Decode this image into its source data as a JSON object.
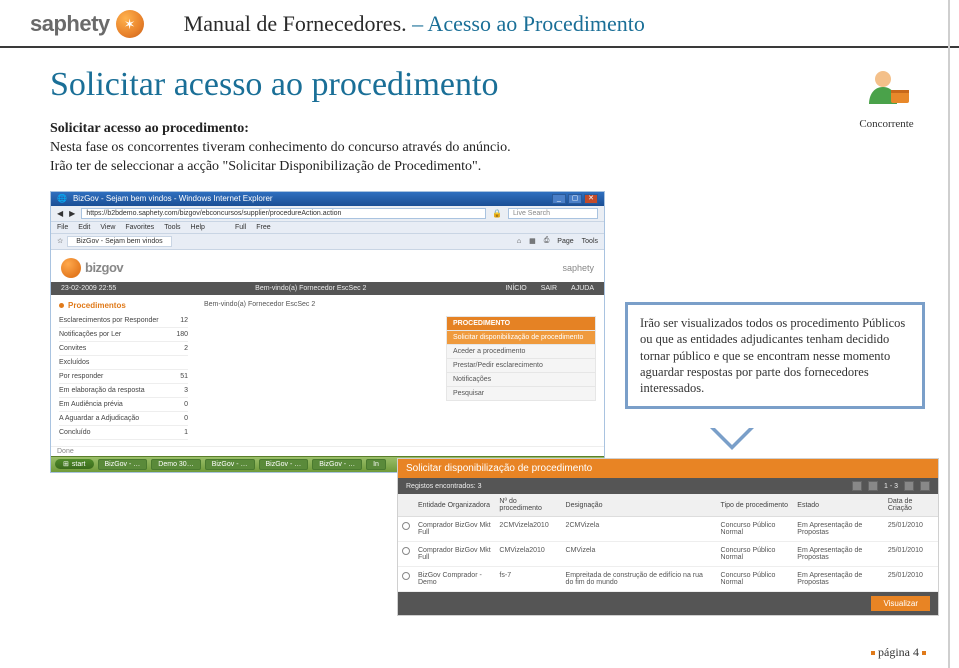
{
  "logo": {
    "text": "saphety"
  },
  "doc_title": {
    "prefix": "Manual de Fornecedores.",
    "suffix": " – Acesso ao Procedimento"
  },
  "page_heading": "Solicitar acesso ao procedimento",
  "intro": {
    "bold": "Solicitar acesso ao procedimento:",
    "line1": "Nesta fase os concorrentes tiveram conhecimento do concurso através do anúncio. Irão ter de seleccionar a acção \"Solicitar Disponibilização de Procedimento\"."
  },
  "badge_label": "Concorrente",
  "callout_text": "Irão ser visualizados todos os procedimento Públicos ou que as entidades adjudicantes tenham decidido tornar público e que se encontram nesse momento aguardar respostas por parte dos fornecedores interessados.",
  "browser": {
    "title": "BizGov - Sejam bem vindos - Windows Internet Explorer",
    "url": "https://b2bdemo.saphety.com/bizgov/ebconcursos/supplier/procedureAction.action",
    "search_placeholder": "Live Search",
    "menu": [
      "File",
      "Edit",
      "View",
      "Favorites",
      "Tools",
      "Help",
      "Full",
      "Free"
    ],
    "tab_label": "BizGov - Sejam bem vindos",
    "toolbar_right": [
      "Page",
      "Tools"
    ]
  },
  "app": {
    "bizgov": "bizgov",
    "saphety_small": "saphety",
    "darkbar_date": "23-02-2009 22:55",
    "darkbar_welcome": "Bem-vindo(a) Fornecedor EscSec 2",
    "darkbar_links": [
      "INÍCIO",
      "SAIR",
      "AJUDA"
    ],
    "sidebar_head": "Procedimentos",
    "sidebar_items": [
      {
        "label": "Esclarecimentos por Responder",
        "count": "12"
      },
      {
        "label": "Notificações por Ler",
        "count": "180"
      },
      {
        "label": "Convites",
        "count": "2"
      },
      {
        "label": "Excluídos",
        "count": ""
      },
      {
        "label": "Por responder",
        "count": "51"
      },
      {
        "label": "Em elaboração da resposta",
        "count": "3"
      },
      {
        "label": "Em Audiência prévia",
        "count": "0"
      },
      {
        "label": "A Aguardar a Adjudicação",
        "count": "0"
      },
      {
        "label": "Concluído",
        "count": "1"
      }
    ],
    "main_welcome": "Bem-vindo(a) Fornecedor EscSec 2",
    "proc_head": "PROCEDIMENTO",
    "proc_items": [
      {
        "label": "Solicitar disponibilização de procedimento",
        "active": true
      },
      {
        "label": "Aceder a procedimento",
        "active": false
      },
      {
        "label": "Prestar/Pedir esclarecimento",
        "active": false
      },
      {
        "label": "Notificações",
        "active": false
      },
      {
        "label": "Pesquisar",
        "active": false
      }
    ]
  },
  "taskbar": {
    "start": "start",
    "items": [
      "BizGov - …",
      "Demo 30…",
      "BizGov - …",
      "BizGov - …",
      "BizGov - …",
      "In"
    ]
  },
  "table": {
    "title": "Solicitar disponibilização de procedimento",
    "records_label": "Registos encontrados: 3",
    "pager_label": "1 - 3",
    "columns": [
      "",
      "Entidade Organizadora",
      "Nº do procedimento",
      "Designação",
      "Tipo de procedimento",
      "Estado",
      "Data de Criação"
    ],
    "rows": [
      {
        "org": "Comprador BizGov Mkt Full",
        "num": "2CMVizela2010",
        "des": "2CMVizela",
        "tipo": "Concurso Público Normal",
        "estado": "Em Apresentação de Propostas",
        "data": "25/01/2010"
      },
      {
        "org": "Comprador BizGov Mkt Full",
        "num": "CMVizela2010",
        "des": "CMVizela",
        "tipo": "Concurso Público Normal",
        "estado": "Em Apresentação de Propostas",
        "data": "25/01/2010"
      },
      {
        "org": "BizGov Comprador - Demo",
        "num": "fs-7",
        "des": "Empreitada de construção de edifício na rua do fim do mundo",
        "tipo": "Concurso Público Normal",
        "estado": "Em Apresentação de Propostas",
        "data": "25/01/2010"
      }
    ],
    "button": "Visualizar"
  },
  "page_number": "página 4"
}
